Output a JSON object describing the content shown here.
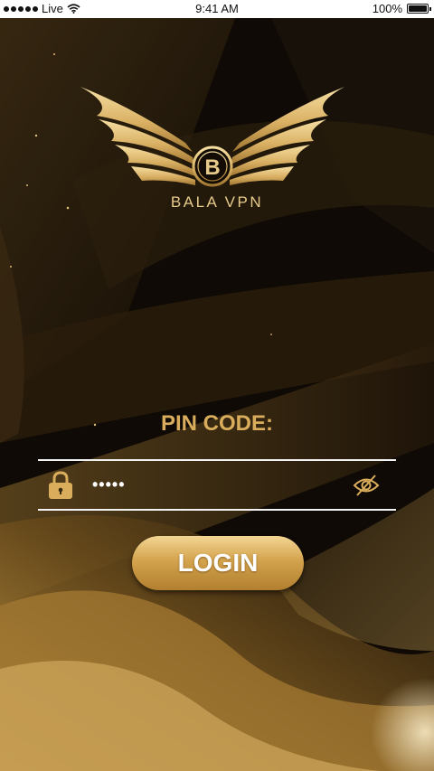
{
  "status_bar": {
    "carrier": "Live",
    "time": "9:41 AM",
    "battery": "100%"
  },
  "logo": {
    "monogram": "B",
    "brand": "BALA VPN"
  },
  "form": {
    "pin_label": "PIN CODE:",
    "pin_value": "•••••",
    "login_label": "LOGIN"
  },
  "icons": {
    "lock": "lock-icon",
    "eye": "eye-slash-icon",
    "wifi": "wifi-icon",
    "battery": "battery-icon"
  },
  "colors": {
    "gold": "#d9ad5b",
    "gold_light": "#f3d693",
    "background": "#0d0905"
  }
}
